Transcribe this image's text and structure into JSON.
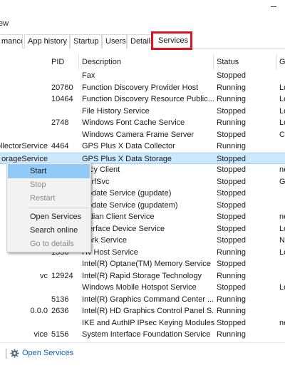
{
  "window": {
    "minimize_glyph": "—"
  },
  "menubar": {
    "view_label": "ew"
  },
  "tabs": [
    {
      "label": "mance"
    },
    {
      "label": "App history"
    },
    {
      "label": "Startup"
    },
    {
      "label": "Users"
    },
    {
      "label": "Details"
    },
    {
      "label": "Services",
      "active": true
    }
  ],
  "columns": {
    "pid": "PID",
    "description": "Description",
    "status": "Status",
    "group": "Gr"
  },
  "rows": [
    {
      "name": "",
      "pid": "",
      "description": "Fax",
      "status": "Stopped",
      "group": ""
    },
    {
      "name": "",
      "pid": "20760",
      "description": "Function Discovery Provider Host",
      "status": "Running",
      "group": "Lo"
    },
    {
      "name": "",
      "pid": "10464",
      "description": "Function Discovery Resource Public...",
      "status": "Running",
      "group": "Lo"
    },
    {
      "name": "",
      "pid": "",
      "description": "File History Service",
      "status": "Stopped",
      "group": "Lo"
    },
    {
      "name": "",
      "pid": "2748",
      "description": "Windows Font Cache Service",
      "status": "Running",
      "group": "Lo"
    },
    {
      "name": "",
      "pid": "",
      "description": "Windows Camera Frame Server",
      "status": "Stopped",
      "group": "Ca"
    },
    {
      "name": "ollectorService",
      "pid": "4464",
      "description": "GPS Plus X Data Collector",
      "status": "Running",
      "group": ""
    },
    {
      "name": "orageService",
      "pid": "",
      "description": "GPS Plus X Data Storage",
      "status": "Stopped",
      "group": "",
      "selected": true
    },
    {
      "name": "",
      "pid": "",
      "description": "olicy Client",
      "status": "Stopped",
      "group": "ne"
    },
    {
      "name": "",
      "pid": "",
      "description": "PerfSvc",
      "status": "Stopped",
      "group": "Gr"
    },
    {
      "name": "",
      "pid": "",
      "description": "Update Service (gupdate)",
      "status": "Stopped",
      "group": ""
    },
    {
      "name": "",
      "pid": "",
      "description": "Update Service (gupdatem)",
      "status": "Stopped",
      "group": ""
    },
    {
      "name": "",
      "pid": "",
      "description": "ardian Client Service",
      "status": "Stopped",
      "group": "ne"
    },
    {
      "name": "",
      "pid": "",
      "description": "nterface Device Service",
      "status": "Stopped",
      "group": "Lo"
    },
    {
      "name": "",
      "pid": "",
      "description": "work Service",
      "status": "Stopped",
      "group": "N"
    },
    {
      "name": "",
      "pid": "1556",
      "description": "Hv Host Service",
      "status": "Running",
      "group": "Lo"
    },
    {
      "name": "",
      "pid": "",
      "description": "Intel(R) Optane(TM) Memory Service",
      "status": "Stopped",
      "group": ""
    },
    {
      "name": "vc",
      "pid": "12924",
      "description": "Intel(R) Rapid Storage Technology",
      "status": "Running",
      "group": ""
    },
    {
      "name": "",
      "pid": "",
      "description": "Windows Mobile Hotspot Service",
      "status": "Stopped",
      "group": "Lo"
    },
    {
      "name": "",
      "pid": "5136",
      "description": "Intel(R) Graphics Command Center ...",
      "status": "Running",
      "group": ""
    },
    {
      "name": "0.0.0",
      "pid": "2636",
      "description": "Intel(R) HD Graphics Control Panel S...",
      "status": "Running",
      "group": ""
    },
    {
      "name": "",
      "pid": "",
      "description": "IKE and AuthIP IPsec Keying Modules",
      "status": "Stopped",
      "group": "ne"
    },
    {
      "name": "vice",
      "pid": "5156",
      "description": "System Interface Foundation Service",
      "status": "Running",
      "group": ""
    }
  ],
  "context_menu": {
    "items": [
      {
        "label": "Start",
        "state": "highlight"
      },
      {
        "label": "Stop",
        "state": "disabled"
      },
      {
        "label": "Restart",
        "state": "disabled"
      },
      {
        "label": "Open Services",
        "state": "normal"
      },
      {
        "label": "Search online",
        "state": "normal"
      },
      {
        "label": "Go to details",
        "state": "disabled"
      }
    ]
  },
  "footer": {
    "link_label": "Open Services",
    "icon": "gear-icon"
  }
}
